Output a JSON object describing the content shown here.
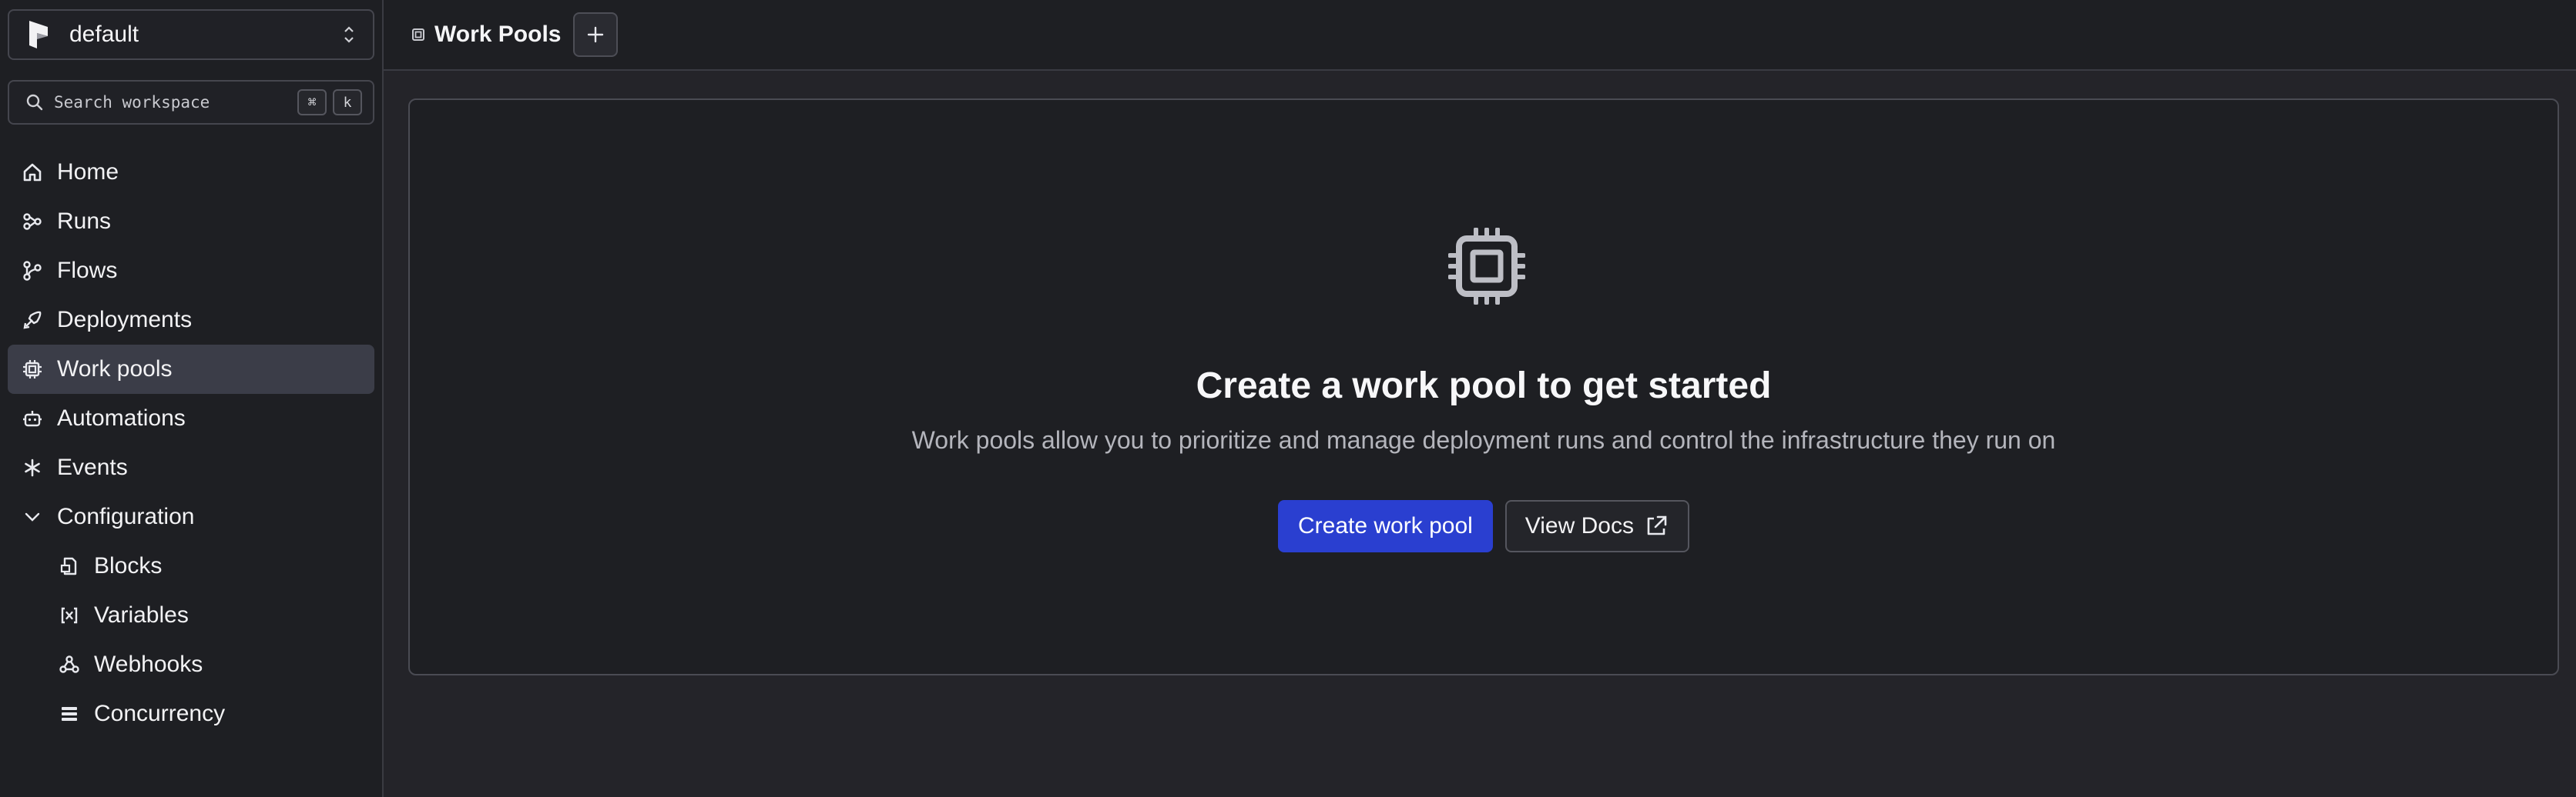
{
  "workspace": {
    "name": "default"
  },
  "search": {
    "placeholder": "Search workspace",
    "kbd_cmd": "⌘",
    "kbd_key": "k"
  },
  "nav": {
    "home": "Home",
    "runs": "Runs",
    "flows": "Flows",
    "deployments": "Deployments",
    "work_pools": "Work pools",
    "automations": "Automations",
    "events": "Events",
    "configuration": "Configuration",
    "blocks": "Blocks",
    "variables": "Variables",
    "webhooks": "Webhooks",
    "concurrency": "Concurrency"
  },
  "header": {
    "title": "Work Pools"
  },
  "empty_state": {
    "title": "Create a work pool to get started",
    "description": "Work pools allow you to prioritize and manage deployment runs and control the infrastructure they run on",
    "primary_button": "Create work pool",
    "secondary_button": "View Docs"
  },
  "colors": {
    "accent": "#2a3fd0",
    "active_nav": "#3b3d48",
    "background": "#242429"
  },
  "icons": {
    "logo": "prefect-logo",
    "home": "home-icon",
    "runs": "runs-icon",
    "flows": "flows-icon",
    "deployments": "rocket-icon",
    "work_pools": "cpu-icon",
    "automations": "bot-icon",
    "events": "asterisk-icon",
    "configuration": "chevron-down-icon",
    "blocks": "blocks-icon",
    "variables": "variable-icon",
    "webhooks": "webhook-icon",
    "concurrency": "layers-icon",
    "external": "external-link-icon"
  }
}
